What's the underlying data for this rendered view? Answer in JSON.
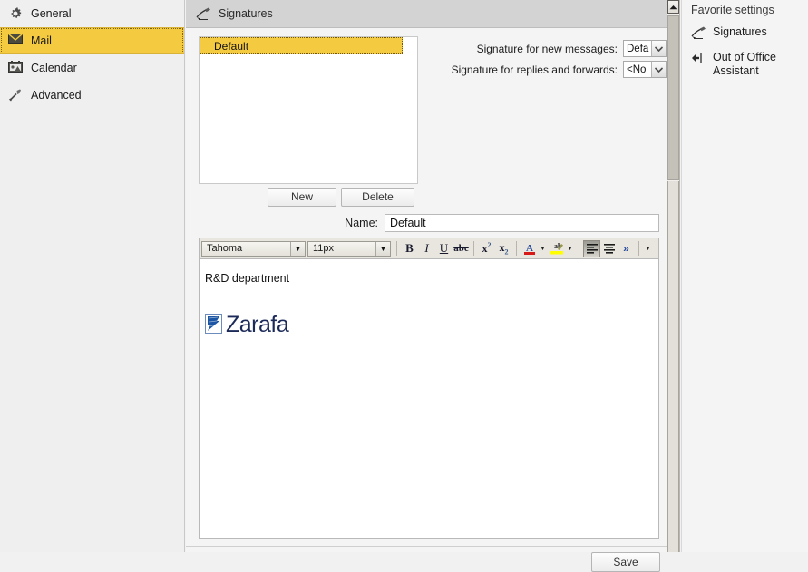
{
  "sidebar": {
    "items": [
      {
        "label": "General",
        "icon": "gear-icon",
        "selected": false
      },
      {
        "label": "Mail",
        "icon": "envelope-icon",
        "selected": true
      },
      {
        "label": "Calendar",
        "icon": "calendar-icon",
        "selected": false
      },
      {
        "label": "Advanced",
        "icon": "wrench-icon",
        "selected": false
      }
    ]
  },
  "main": {
    "header": {
      "title": "Signatures",
      "icon": "signature-pen-icon"
    },
    "signature_list": {
      "items": [
        {
          "label": "Default",
          "selected": true
        }
      ]
    },
    "selects": [
      {
        "label": "Signature for new messages:",
        "value": "Default",
        "display": "Defa"
      },
      {
        "label": "Signature for replies and forwards:",
        "value": "<None>",
        "display": "<No"
      }
    ],
    "buttons": {
      "new_label": "New",
      "delete_label": "Delete",
      "save_label": "Save"
    },
    "name_field": {
      "label": "Name:",
      "value": "Default"
    },
    "editor": {
      "font_family": "Tahoma",
      "font_size": "11px",
      "tools": [
        {
          "name": "bold-icon",
          "glyph": "B"
        },
        {
          "name": "italic-icon",
          "glyph": "I"
        },
        {
          "name": "underline-icon",
          "glyph": "U"
        },
        {
          "name": "strikethrough-icon",
          "glyph": "abc"
        },
        {
          "name": "superscript-icon",
          "glyph": "x²"
        },
        {
          "name": "subscript-icon",
          "glyph": "x₂"
        },
        {
          "name": "font-color-icon",
          "glyph": "A"
        },
        {
          "name": "highlight-color-icon",
          "glyph": "ab"
        },
        {
          "name": "align-left-icon",
          "glyph": ""
        },
        {
          "name": "align-center-icon",
          "glyph": ""
        },
        {
          "name": "more-tools-icon",
          "glyph": "»"
        }
      ],
      "content": {
        "line1": "R&D department",
        "logo_text": "Zarafa"
      }
    }
  },
  "favorites": {
    "title": "Favorite settings",
    "items": [
      {
        "label": "Signatures",
        "icon": "signature-pen-icon"
      },
      {
        "label": "Out of Office Assistant",
        "icon": "out-of-office-icon"
      }
    ]
  },
  "colors": {
    "accent_yellow": "#f4ca41",
    "header_gray": "#d3d3d3",
    "font_color_swatch": "#d61a1a",
    "highlight_swatch": "#ffff00",
    "logo_blue": "#1b56a4",
    "logo_text": "#1b2a58"
  }
}
